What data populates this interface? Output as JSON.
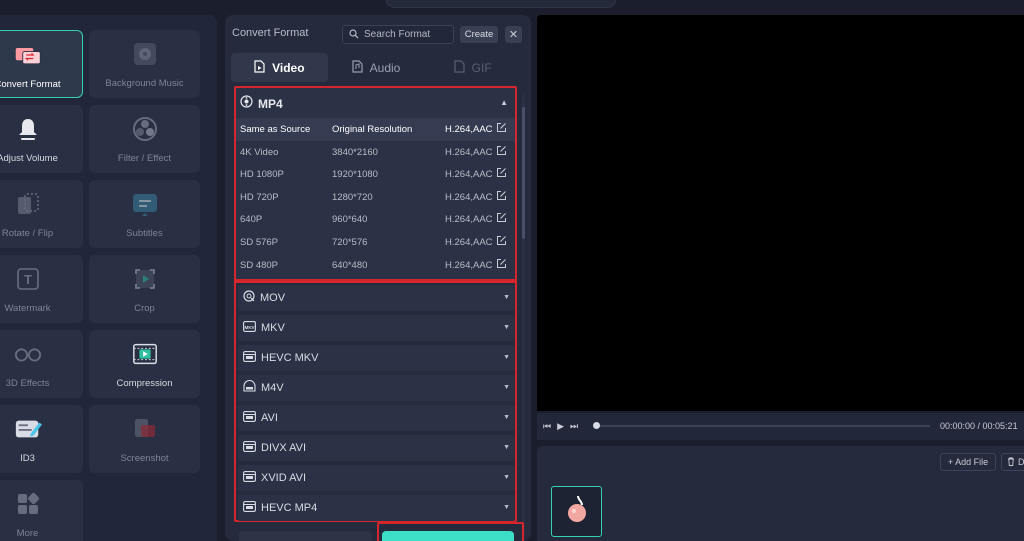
{
  "tools": [
    {
      "label": "Convert Format",
      "icon": "convert-format-icon",
      "active": true,
      "dim": false
    },
    {
      "label": "Background Music",
      "icon": "music-icon",
      "active": false,
      "dim": true
    },
    {
      "label": "Adjust Volume",
      "icon": "volume-icon",
      "active": false,
      "dim": false
    },
    {
      "label": "Filter / Effect",
      "icon": "filter-icon",
      "active": false,
      "dim": true
    },
    {
      "label": "Rotate / Flip",
      "icon": "rotate-icon",
      "active": false,
      "dim": true
    },
    {
      "label": "Subtitles",
      "icon": "subtitles-icon",
      "active": false,
      "dim": true
    },
    {
      "label": "Watermark",
      "icon": "watermark-icon",
      "active": false,
      "dim": true
    },
    {
      "label": "Crop",
      "icon": "crop-icon",
      "active": false,
      "dim": true
    },
    {
      "label": "3D Effects",
      "icon": "3d-glasses-icon",
      "active": false,
      "dim": true
    },
    {
      "label": "Compression",
      "icon": "compression-icon",
      "active": false,
      "dim": false
    },
    {
      "label": "ID3",
      "icon": "id3-icon",
      "active": false,
      "dim": false
    },
    {
      "label": "Screenshot",
      "icon": "screenshot-icon",
      "active": false,
      "dim": true
    },
    {
      "label": "More",
      "icon": "more-icon",
      "active": false,
      "dim": true
    }
  ],
  "format_panel": {
    "title": "Convert Format",
    "search_placeholder": "Search Format",
    "create_label": "Create",
    "close_label": "✕",
    "tabs": [
      {
        "label": "Video",
        "active": true
      },
      {
        "label": "Audio",
        "active": false
      },
      {
        "label": "GIF",
        "active": false,
        "disabled": true
      }
    ],
    "expanded_group": {
      "name": "MP4",
      "rows": [
        {
          "name": "Same as Source",
          "resolution": "Original Resolution",
          "codec": "H.264,AAC",
          "selected": true
        },
        {
          "name": "4K Video",
          "resolution": "3840*2160",
          "codec": "H.264,AAC"
        },
        {
          "name": "HD 1080P",
          "resolution": "1920*1080",
          "codec": "H.264,AAC"
        },
        {
          "name": "HD 720P",
          "resolution": "1280*720",
          "codec": "H.264,AAC"
        },
        {
          "name": "640P",
          "resolution": "960*640",
          "codec": "H.264,AAC"
        },
        {
          "name": "SD 576P",
          "resolution": "720*576",
          "codec": "H.264,AAC"
        },
        {
          "name": "SD 480P",
          "resolution": "640*480",
          "codec": "H.264,AAC"
        }
      ]
    },
    "collapsed_groups": [
      "MOV",
      "MKV",
      "HEVC MKV",
      "M4V",
      "AVI",
      "DIVX AVI",
      "XVID AVI",
      "HEVC MP4"
    ]
  },
  "player": {
    "timecode": "00:00:00 / 00:05:21",
    "progress": 0
  },
  "files": {
    "add_label": "+ Add File",
    "delete_label": "D"
  },
  "colors": {
    "accent": "#3de0c6",
    "highlight_box": "#d6262d",
    "background": "#1b1f2d"
  }
}
